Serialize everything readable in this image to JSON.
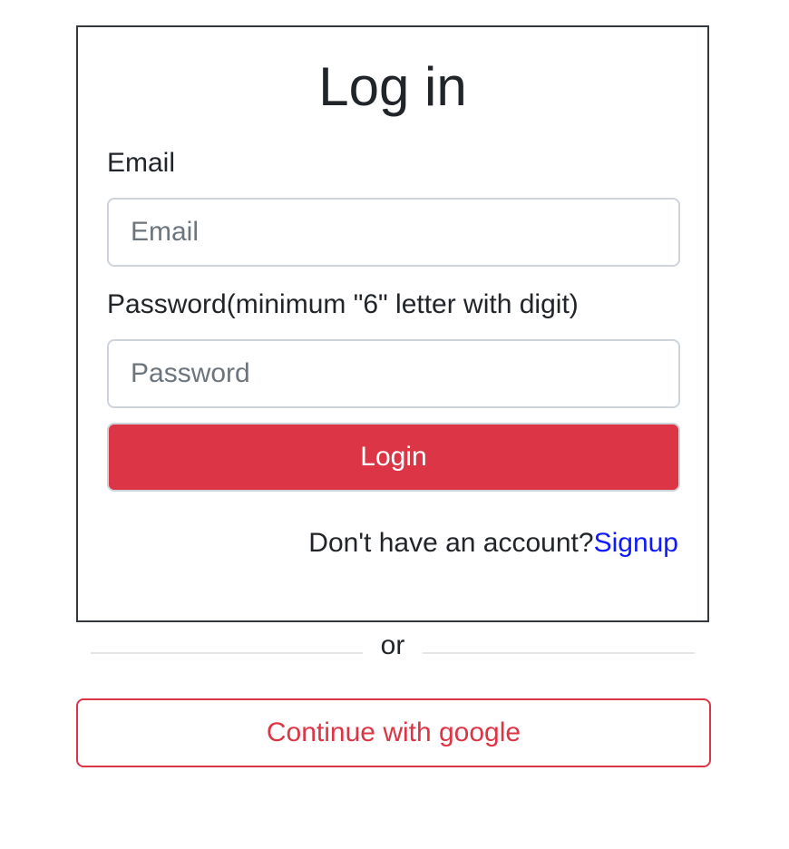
{
  "login_card": {
    "title": "Log in",
    "email_label": "Email",
    "email_placeholder": "Email",
    "email_value": "",
    "password_label": "Password(minimum \"6\" letter with digit)",
    "password_placeholder": "Password",
    "password_value": "",
    "login_button_label": "Login",
    "signup_prompt": "Don't have an account?",
    "signup_link_label": "Signup"
  },
  "divider": {
    "text": "or"
  },
  "google_button_label": "Continue with google",
  "colors": {
    "primary_red": "#dc3545",
    "link_blue": "#0d1aff",
    "card_border": "#343a40",
    "input_border": "#ced4da"
  }
}
